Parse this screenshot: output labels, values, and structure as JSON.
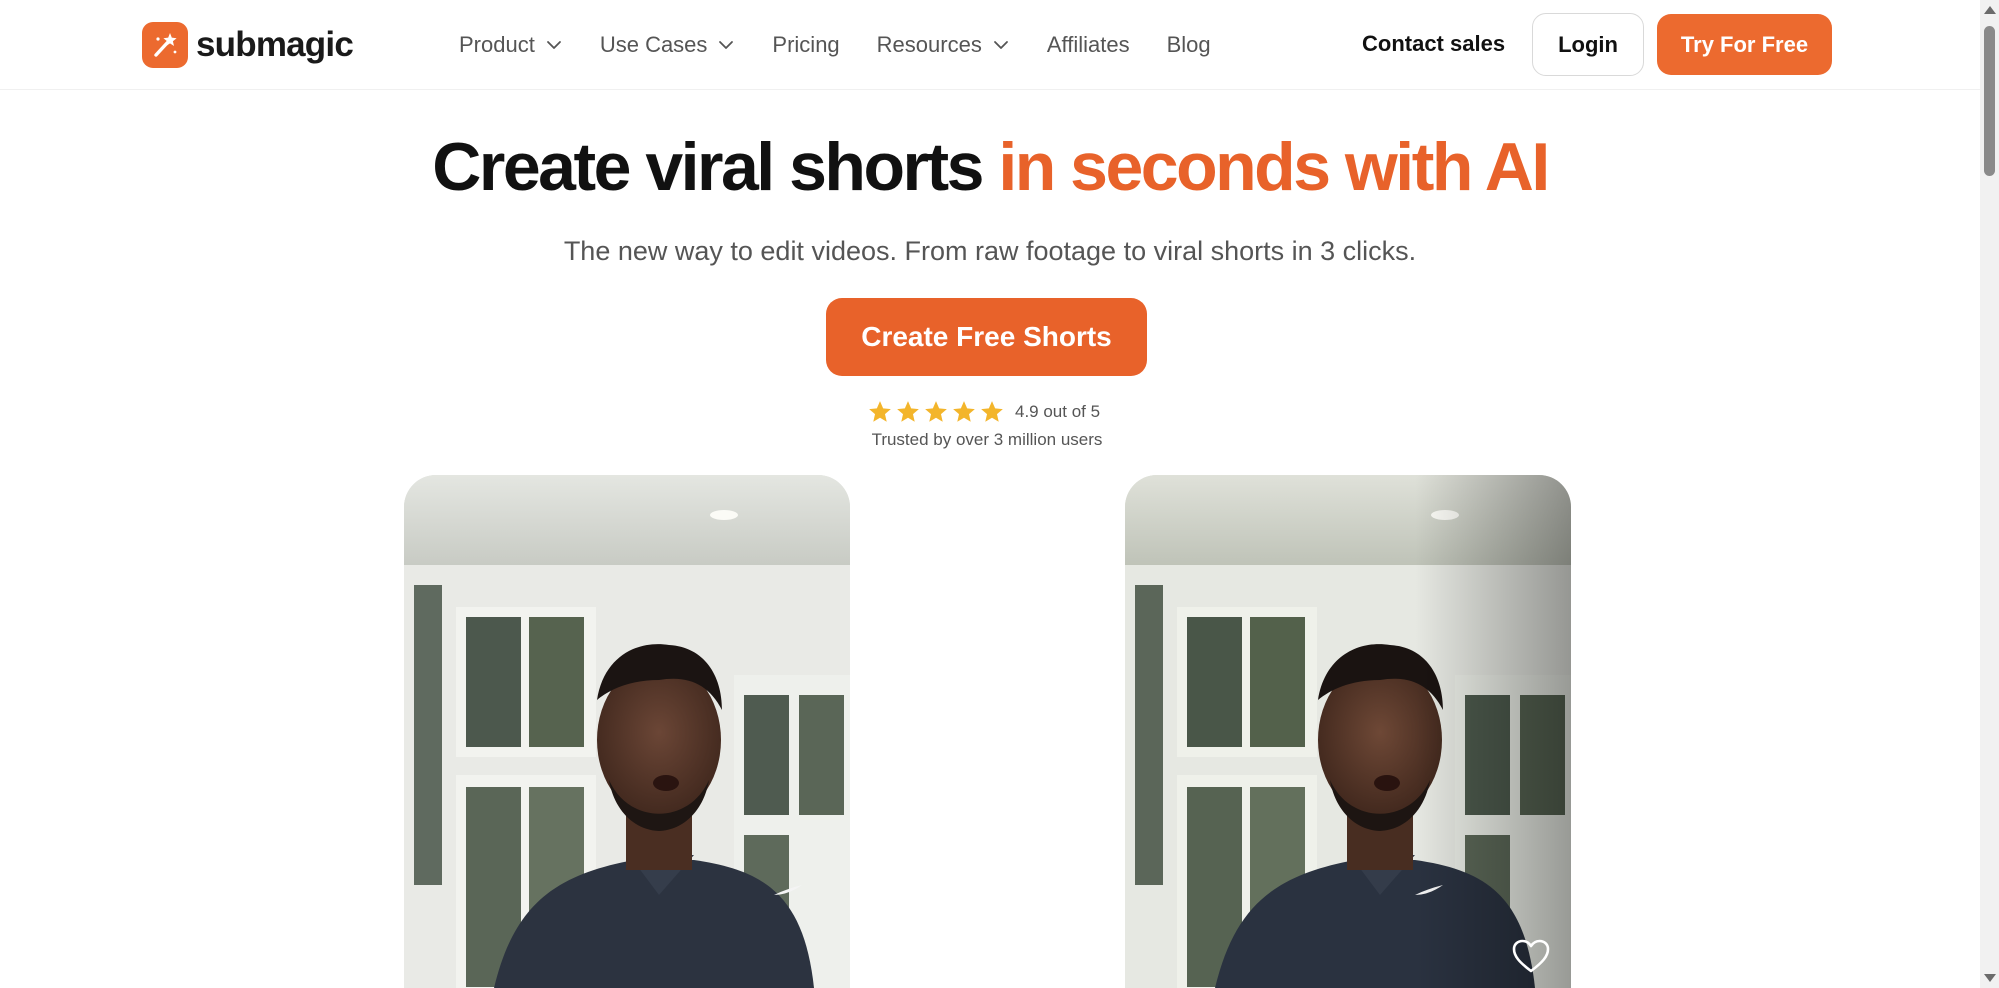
{
  "brand": {
    "name": "submagic",
    "icon": "magic-wand-icon",
    "color": "#ec6a2f"
  },
  "nav": {
    "items": [
      {
        "label": "Product",
        "dropdown": true
      },
      {
        "label": "Use Cases",
        "dropdown": true
      },
      {
        "label": "Pricing",
        "dropdown": false
      },
      {
        "label": "Resources",
        "dropdown": true
      },
      {
        "label": "Affiliates",
        "dropdown": false
      },
      {
        "label": "Blog",
        "dropdown": false
      }
    ],
    "contact_label": "Contact sales",
    "login_label": "Login",
    "try_label": "Try For Free"
  },
  "hero": {
    "headline_main": "Create viral shorts ",
    "headline_accent": "in seconds with AI",
    "subline": "The new way to edit videos. From raw footage to viral shorts in 3 clicks.",
    "cta_label": "Create Free Shorts",
    "rating_value": "4.9 out of 5",
    "stars": 5,
    "trusted": "Trusted by over 3 million users"
  },
  "colors": {
    "accent": "#e8622a",
    "text": "#111111",
    "muted": "#555555"
  },
  "videos": [
    {
      "name": "raw-video",
      "icon": null
    },
    {
      "name": "edited-video",
      "icon": "heart-icon"
    }
  ]
}
